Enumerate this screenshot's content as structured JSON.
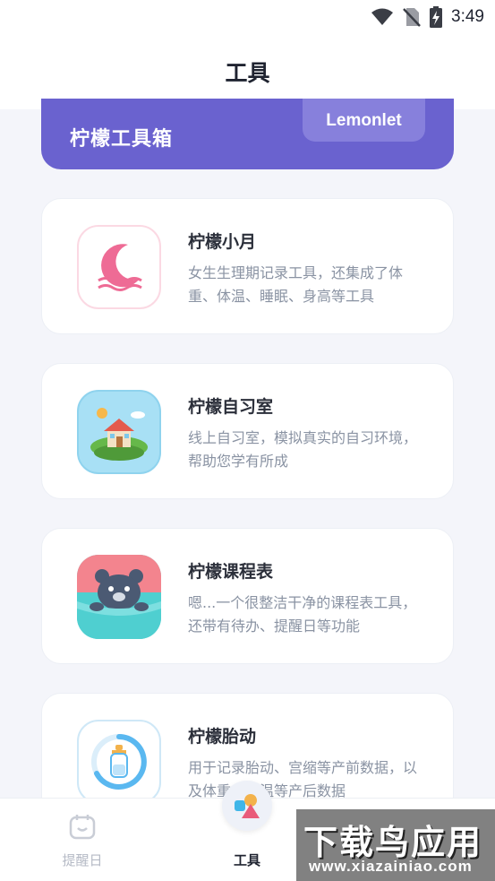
{
  "status_bar": {
    "time": "3:49",
    "icons": [
      "wifi-icon",
      "no-sim-icon",
      "battery-charging-icon"
    ]
  },
  "header": {
    "title": "工具"
  },
  "banner": {
    "title": "柠檬工具箱",
    "badge": "Lemonlet",
    "color": "#6a62cf"
  },
  "cards": [
    {
      "title": "柠檬小月",
      "description": "女生生理期记录工具，还集成了体重、体温、睡眠、身高等工具",
      "icon": "moon-waves-icon"
    },
    {
      "title": "柠檬自习室",
      "description": "线上自习室，模拟真实的自习环境，帮助您学有所成",
      "icon": "house-island-icon"
    },
    {
      "title": "柠檬课程表",
      "description": "嗯...一个很整洁干净的课程表工具，还带有待办、提醒日等功能",
      "icon": "bear-icon"
    },
    {
      "title": "柠檬胎动",
      "description": "用于记录胎动、宫缩等产前数据，以及体重、体温等产后数据",
      "icon": "baby-bottle-icon"
    }
  ],
  "tabbar": {
    "reminder_label": "提醒日",
    "tools_label": "工具"
  },
  "watermark": {
    "big": "下载鸟应用",
    "small": "www.xiazainiao.com"
  },
  "colors": {
    "accent": "#6a62cf",
    "background": "#f4f5fa",
    "text_primary": "#2b2f3a",
    "text_secondary": "#8a93a3"
  }
}
